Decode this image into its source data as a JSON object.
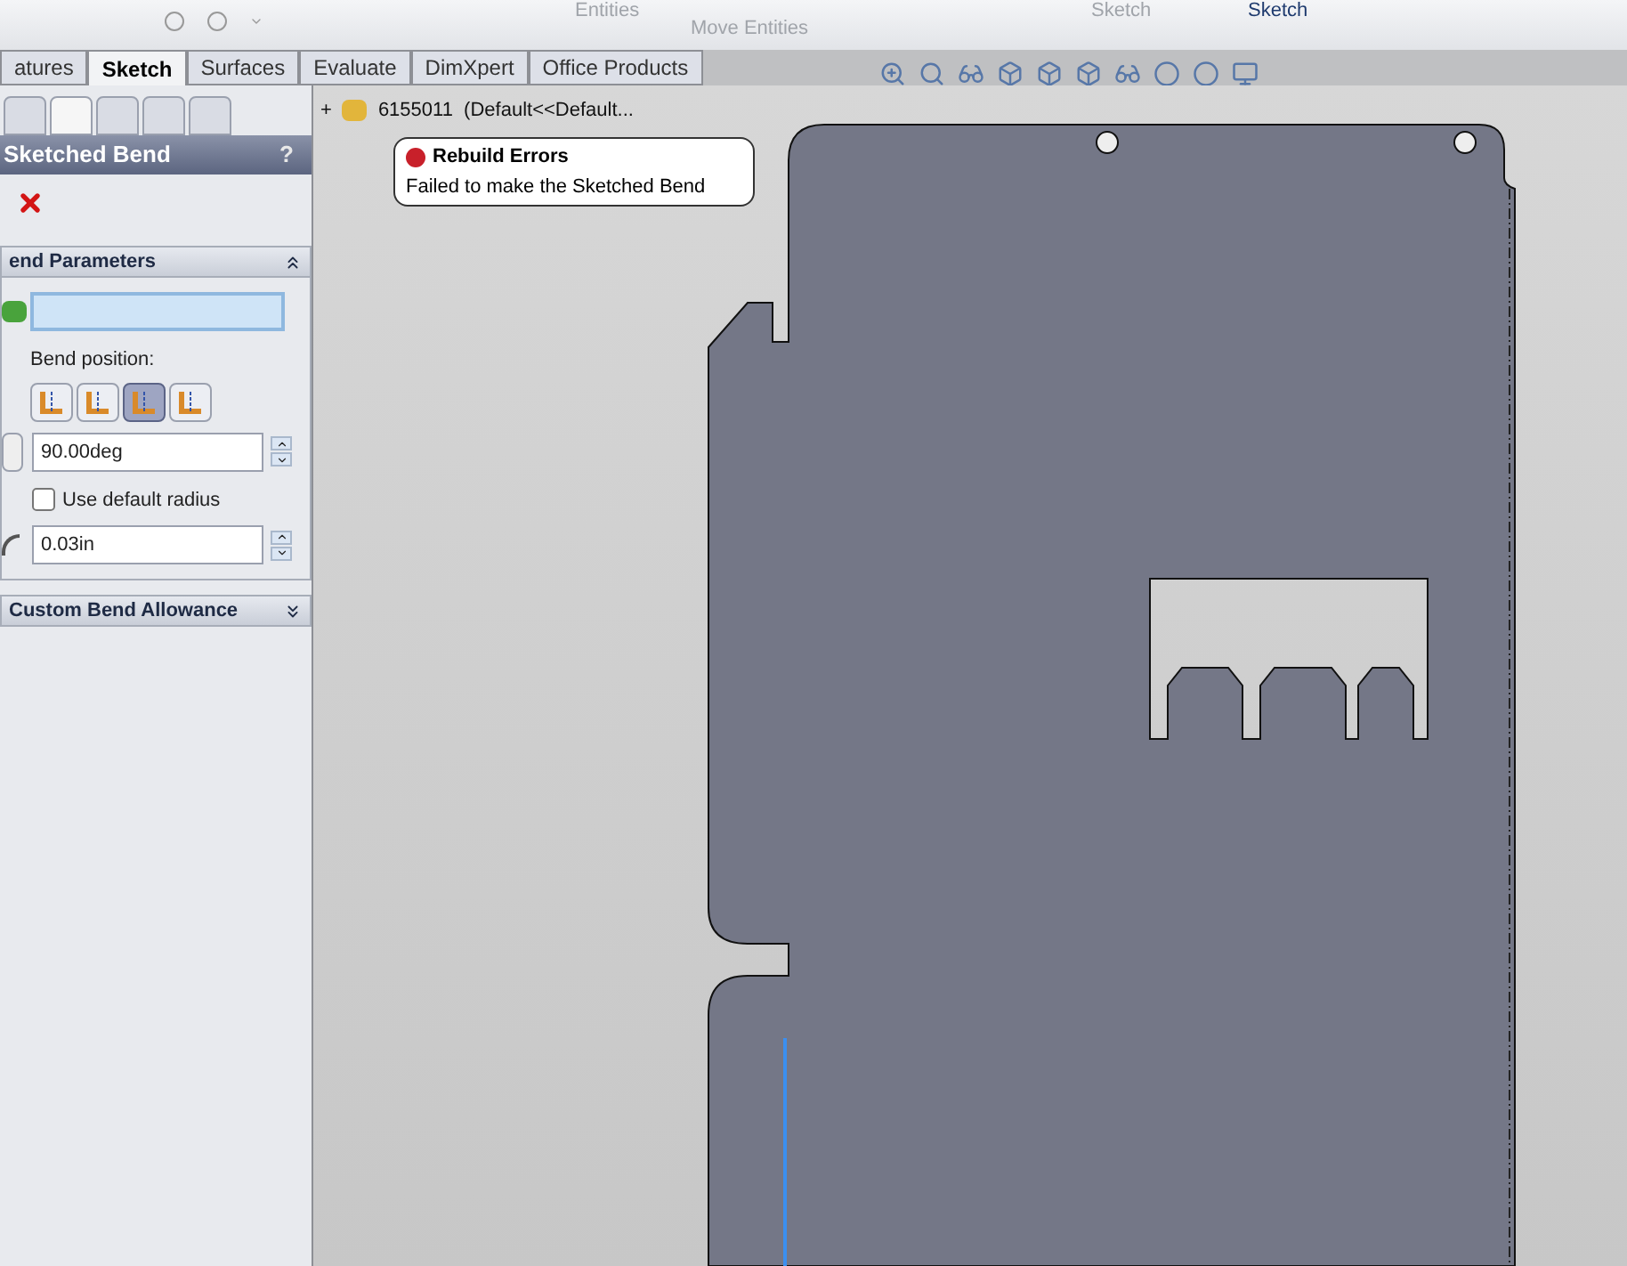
{
  "ribbon": {
    "labels": [
      {
        "text": "Entities",
        "disabled": true
      },
      {
        "text": "Move Entities",
        "disabled": true
      },
      {
        "text": "Sketch",
        "disabled": true
      },
      {
        "text": "Sketch",
        "disabled": false
      }
    ]
  },
  "tabs": [
    {
      "label": "atures",
      "selected": false
    },
    {
      "label": "Sketch",
      "selected": true
    },
    {
      "label": "Surfaces",
      "selected": false
    },
    {
      "label": "Evaluate",
      "selected": false
    },
    {
      "label": "DimXpert",
      "selected": false
    },
    {
      "label": "Office Products",
      "selected": false
    }
  ],
  "property_manager": {
    "title": "Sketched Bend",
    "help": "?",
    "sections": [
      {
        "kind": "parameters",
        "title": "end Parameters",
        "expanded": true,
        "bend_position_label": "Bend position:",
        "positions": [
          {
            "selected": false
          },
          {
            "selected": false
          },
          {
            "selected": true
          },
          {
            "selected": false
          }
        ],
        "angle": "90.00deg",
        "default_radius": {
          "label": "Use default radius",
          "checked": false
        },
        "radius": "0.03in"
      },
      {
        "kind": "collapsed",
        "title": "Custom Bend Allowance",
        "expanded": false
      }
    ]
  },
  "tree": {
    "expander": "+",
    "label": "6155011  (Default<<Default..."
  },
  "error_balloon": {
    "title": "Rebuild Errors",
    "message": "Failed to make the Sketched Bend"
  }
}
